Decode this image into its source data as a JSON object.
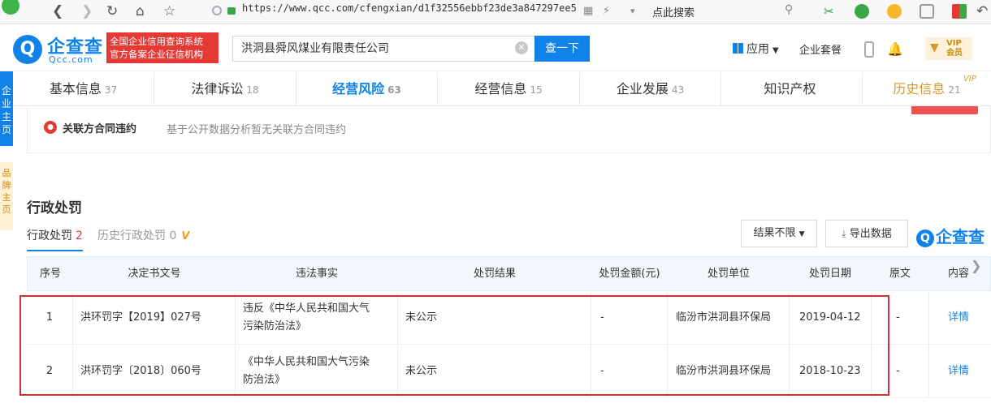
{
  "browser": {
    "url": "https://www.qcc.com/cfengxian/d1f32556ebbf23de3a847297ee5",
    "search_hint": "点此搜索"
  },
  "header": {
    "logo_cn": "企查查",
    "logo_en": "Qcc.com",
    "slogan_line1": "全国企业信用查询系统",
    "slogan_line2": "官方备案企业征信机构",
    "search_value": "洪洞县舜风煤业有限责任公司",
    "search_button": "查一下",
    "app_menu": "应用",
    "enterprise_package": "企业套餐",
    "vip_line1": "VIP",
    "vip_line2": "会员"
  },
  "left_side": {
    "blue_text": "企业主页",
    "yellow_text": "品牌主页"
  },
  "tabs": [
    {
      "label": "基本信息",
      "count": "37"
    },
    {
      "label": "法律诉讼",
      "count": "18"
    },
    {
      "label": "经营风险",
      "count": "63"
    },
    {
      "label": "经营信息",
      "count": "15"
    },
    {
      "label": "企业发展",
      "count": "43"
    },
    {
      "label": "知识产权",
      "count": ""
    },
    {
      "label": "历史信息",
      "count": "21"
    }
  ],
  "vip_tag": "VIP",
  "related_contract": {
    "title": "关联方合同违约",
    "description": "基于公开数据分析暂无关联方合同违约"
  },
  "section": {
    "title": "行政处罚",
    "subtab_active_label": "行政处罚",
    "subtab_active_count": "2",
    "subtab_history_label": "历史行政处罚",
    "subtab_history_count": "0",
    "subtab_history_vip": "V",
    "filter_label": "结果不限",
    "export_label": "导出数据",
    "mini_logo": "企查查"
  },
  "table": {
    "columns": [
      "序号",
      "决定书文号",
      "违法事实",
      "处罚结果",
      "处罚金额(元)",
      "处罚单位",
      "处罚日期",
      "原文",
      "内容"
    ],
    "rows": [
      {
        "index": "1",
        "doc_no": "洪环罚字【2019】027号",
        "fact_line1": "违反《中华人民共和国大气",
        "fact_line2": "污染防治法》",
        "result": "未公示",
        "amount": "-",
        "unit": "临汾市洪洞县环保局",
        "date": "2019-04-12",
        "original": "-",
        "detail": "详情"
      },
      {
        "index": "2",
        "doc_no": "洪环罚字〔2018〕060号",
        "fact_line1": "《中华人民共和国大气污染",
        "fact_line2": "防治法》",
        "result": "未公示",
        "amount": "-",
        "unit": "临汾市洪洞县环保局",
        "date": "2018-10-23",
        "original": "-",
        "detail": "详情"
      }
    ]
  },
  "colors": {
    "brand_blue": "#1183e8",
    "alert_red": "#d32f2f",
    "vip_gold": "#d49a2c"
  }
}
